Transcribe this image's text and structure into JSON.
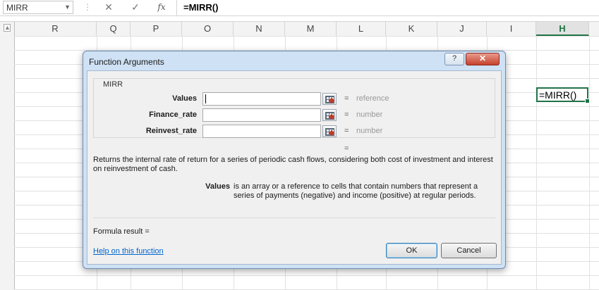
{
  "formula_bar": {
    "name_box": "MIRR",
    "cancel_glyph": "✕",
    "enter_glyph": "✓",
    "fx_label": "fx",
    "formula": "=MIRR()"
  },
  "columns": [
    "R",
    "Q",
    "P",
    "O",
    "N",
    "M",
    "L",
    "K",
    "J",
    "I",
    "H"
  ],
  "active_cell": {
    "column": "H",
    "value": "=MIRR()"
  },
  "dialog": {
    "title": "Function Arguments",
    "help_button": "?",
    "close_button": "✕",
    "function_name": "MIRR",
    "arguments": [
      {
        "label": "Values",
        "value": "",
        "hint": "reference"
      },
      {
        "label": "Finance_rate",
        "value": "",
        "hint": "number"
      },
      {
        "label": "Reinvest_rate",
        "value": "",
        "hint": "number"
      }
    ],
    "equals": "=",
    "description": "Returns the internal rate of return for a series of periodic cash flows, considering both cost of investment and interest on reinvestment of cash.",
    "arg_desc_name": "Values",
    "arg_desc_text": "is an array or a reference to cells that contain numbers that represent a series of payments (negative) and income (positive) at regular periods.",
    "formula_result_label": "Formula result =",
    "help_link": "Help on this function",
    "ok_label": "OK",
    "cancel_label": "Cancel"
  },
  "colors": {
    "excel_green": "#217346",
    "dialog_frame": "#cfe1f4",
    "close_red": "#c7412c",
    "link_blue": "#0066cc"
  }
}
